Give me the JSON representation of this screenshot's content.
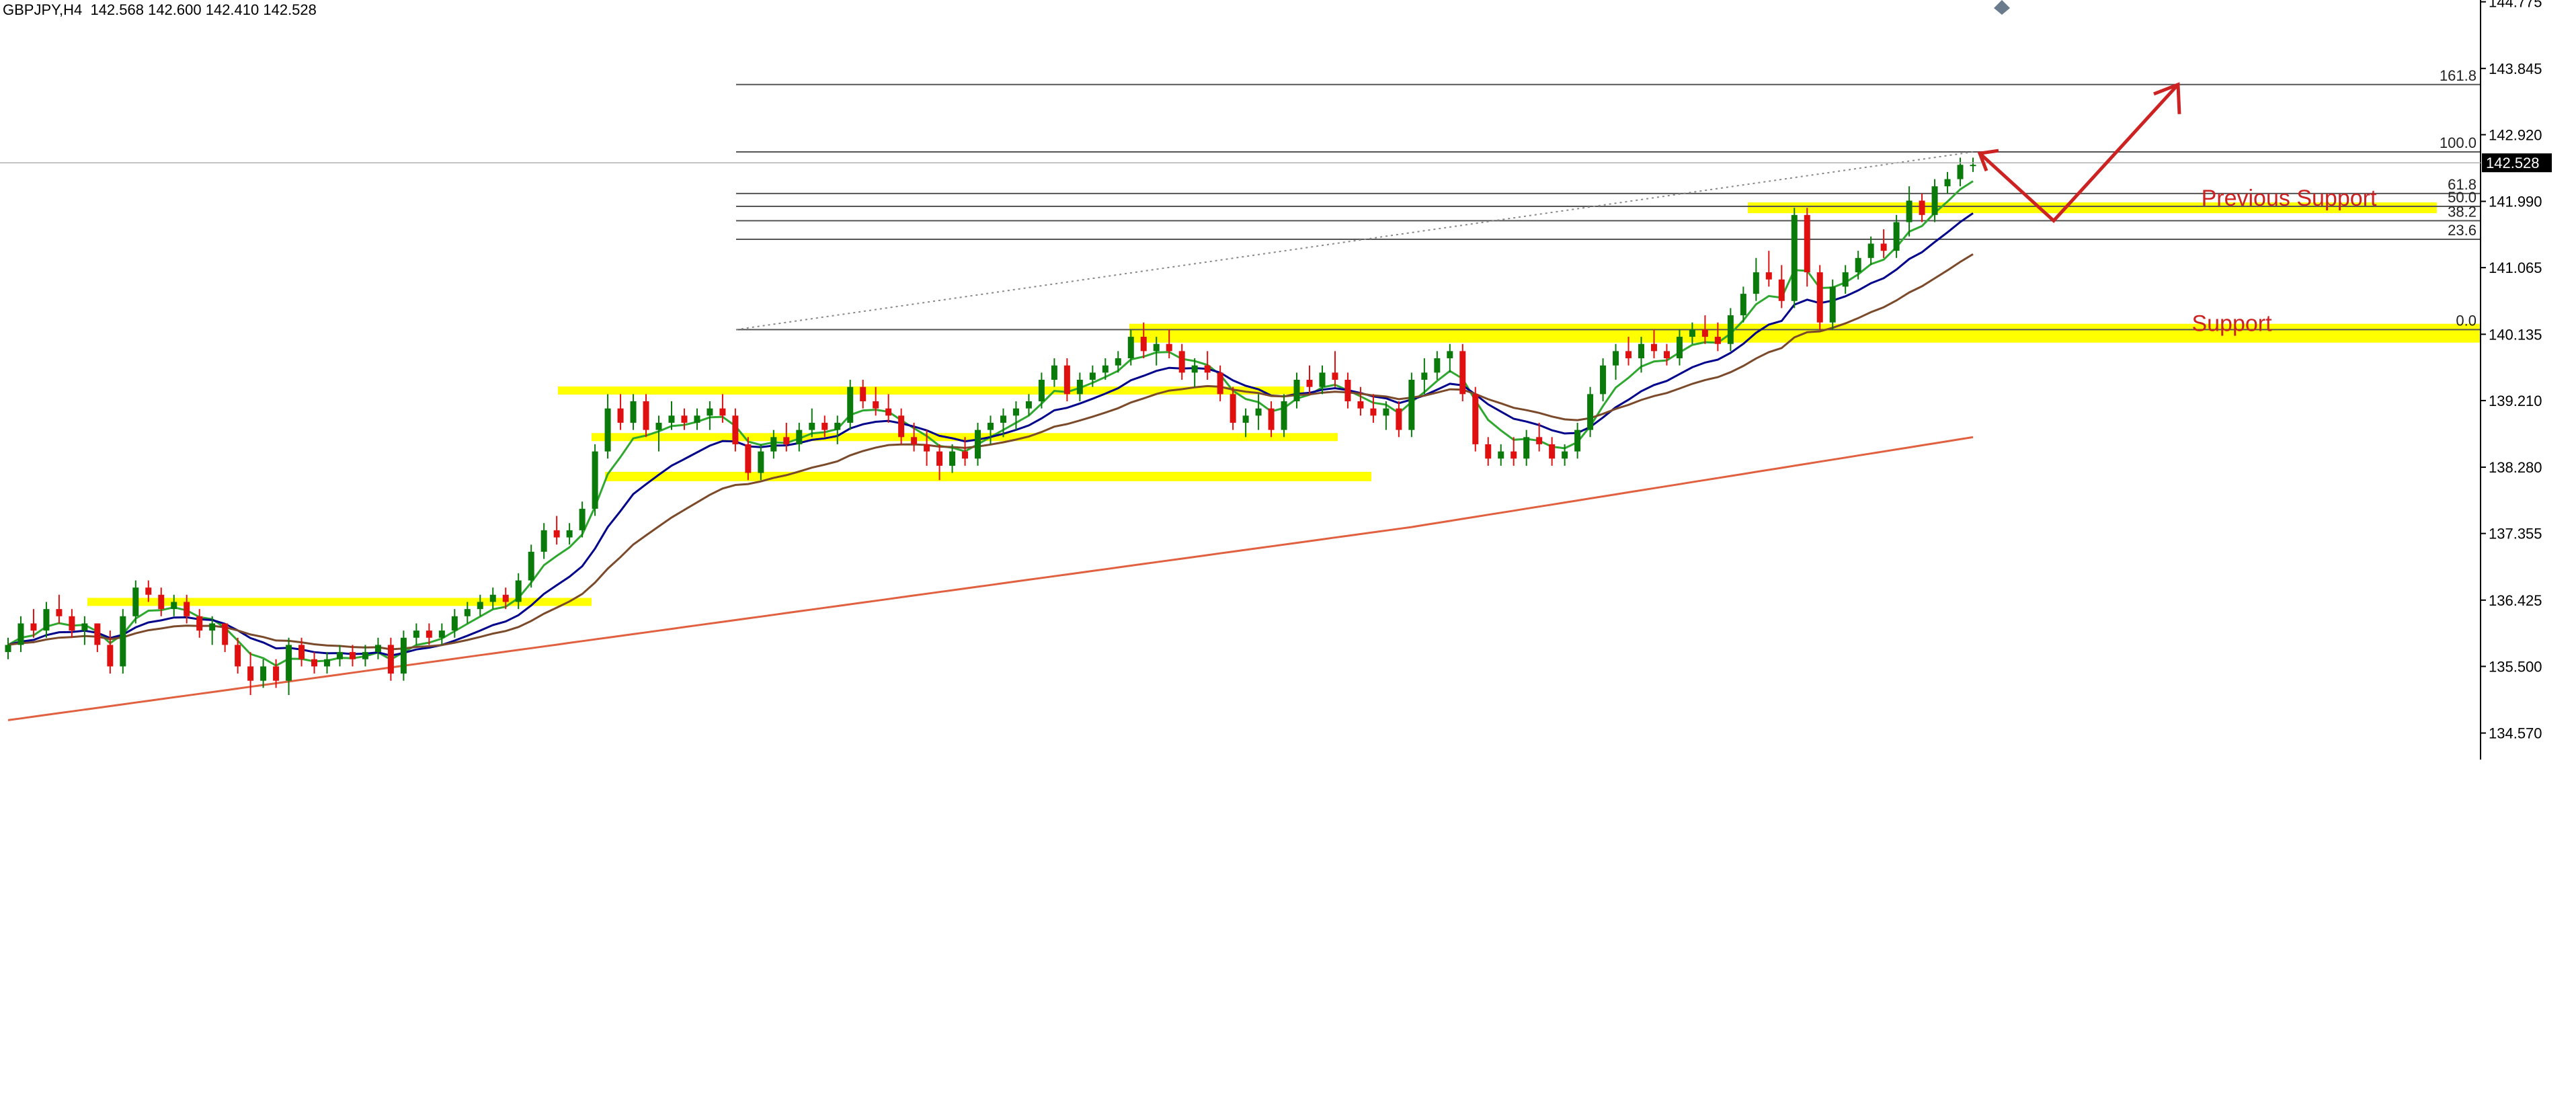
{
  "header": {
    "symbol_timeframe": "GBPJPY,H4",
    "ohlc": "142.568 142.600 142.410 142.528"
  },
  "chart_data": {
    "type": "candlestick",
    "symbol": "GBPJPY",
    "timeframe": "H4",
    "ylim": [
      134.2,
      144.8
    ],
    "price_ticks": [
      "144.775",
      "143.845",
      "142.920",
      "141.990",
      "141.065",
      "140.135",
      "139.210",
      "138.280",
      "137.355",
      "136.425",
      "135.500",
      "134.570"
    ],
    "last_price": "142.528",
    "colors": {
      "up": "#0a7a0a",
      "down": "#e01010",
      "ema_fast": "#2fa82f",
      "ema_mid": "#00008b",
      "ema_slow": "#7b4a2a",
      "ma_long": "#e06040",
      "zone": "#ffff00",
      "arrow": "#cc2222",
      "fib_line": "#555555"
    },
    "fibonacci": [
      {
        "label": "161.8",
        "price": 143.62
      },
      {
        "label": "100.0",
        "price": 142.68
      },
      {
        "label": "61.8",
        "price": 142.1
      },
      {
        "label": "50.0",
        "price": 141.92
      },
      {
        "label": "38.2",
        "price": 141.72
      },
      {
        "label": "23.6",
        "price": 141.46
      },
      {
        "label": "0.0",
        "price": 140.2
      }
    ],
    "annotations": [
      {
        "text": "Previous Support",
        "price": 141.95
      },
      {
        "text": "Support",
        "price": 140.2
      }
    ],
    "zones": [
      {
        "price": 136.4
      },
      {
        "price": 139.35
      },
      {
        "price": 138.7
      },
      {
        "price": 138.15
      },
      {
        "price": 140.15
      },
      {
        "price": 141.9
      }
    ],
    "candles": [
      [
        135.7,
        135.9,
        135.6,
        135.8
      ],
      [
        135.8,
        136.2,
        135.7,
        136.1
      ],
      [
        136.1,
        136.3,
        135.9,
        136.0
      ],
      [
        136.0,
        136.4,
        135.9,
        136.3
      ],
      [
        136.3,
        136.5,
        136.1,
        136.2
      ],
      [
        136.2,
        136.3,
        135.9,
        136.0
      ],
      [
        136.0,
        136.2,
        135.8,
        136.1
      ],
      [
        136.1,
        136.1,
        135.7,
        135.8
      ],
      [
        135.8,
        136.0,
        135.4,
        135.5
      ],
      [
        135.5,
        136.3,
        135.4,
        136.2
      ],
      [
        136.2,
        136.7,
        136.1,
        136.6
      ],
      [
        136.6,
        136.7,
        136.4,
        136.5
      ],
      [
        136.5,
        136.6,
        136.2,
        136.3
      ],
      [
        136.3,
        136.5,
        136.2,
        136.4
      ],
      [
        136.4,
        136.5,
        136.1,
        136.2
      ],
      [
        136.2,
        136.3,
        135.9,
        136.0
      ],
      [
        136.0,
        136.2,
        135.8,
        136.1
      ],
      [
        136.1,
        136.1,
        135.7,
        135.8
      ],
      [
        135.8,
        135.9,
        135.4,
        135.5
      ],
      [
        135.5,
        135.7,
        135.1,
        135.3
      ],
      [
        135.3,
        135.6,
        135.2,
        135.5
      ],
      [
        135.5,
        135.6,
        135.2,
        135.3
      ],
      [
        135.3,
        135.9,
        135.1,
        135.8
      ],
      [
        135.8,
        135.9,
        135.5,
        135.6
      ],
      [
        135.6,
        135.7,
        135.4,
        135.5
      ],
      [
        135.5,
        135.7,
        135.4,
        135.6
      ],
      [
        135.6,
        135.8,
        135.5,
        135.7
      ],
      [
        135.7,
        135.8,
        135.5,
        135.6
      ],
      [
        135.6,
        135.8,
        135.5,
        135.7
      ],
      [
        135.7,
        135.9,
        135.6,
        135.8
      ],
      [
        135.8,
        135.9,
        135.3,
        135.4
      ],
      [
        135.4,
        136.0,
        135.3,
        135.9
      ],
      [
        135.9,
        136.1,
        135.8,
        136.0
      ],
      [
        136.0,
        136.1,
        135.8,
        135.9
      ],
      [
        135.9,
        136.1,
        135.8,
        136.0
      ],
      [
        136.0,
        136.3,
        135.9,
        136.2
      ],
      [
        136.2,
        136.4,
        136.1,
        136.3
      ],
      [
        136.3,
        136.5,
        136.2,
        136.4
      ],
      [
        136.4,
        136.6,
        136.3,
        136.5
      ],
      [
        136.5,
        136.6,
        136.3,
        136.4
      ],
      [
        136.4,
        136.8,
        136.3,
        136.7
      ],
      [
        136.7,
        137.2,
        136.6,
        137.1
      ],
      [
        137.1,
        137.5,
        137.0,
        137.4
      ],
      [
        137.4,
        137.6,
        137.2,
        137.3
      ],
      [
        137.3,
        137.5,
        137.2,
        137.4
      ],
      [
        137.4,
        137.8,
        137.3,
        137.7
      ],
      [
        137.7,
        138.6,
        137.6,
        138.5
      ],
      [
        138.5,
        139.3,
        138.4,
        139.1
      ],
      [
        139.1,
        139.3,
        138.8,
        138.9
      ],
      [
        138.9,
        139.3,
        138.8,
        139.2
      ],
      [
        139.2,
        139.3,
        138.7,
        138.8
      ],
      [
        138.8,
        139.0,
        138.5,
        138.9
      ],
      [
        138.9,
        139.2,
        138.8,
        139.0
      ],
      [
        139.0,
        139.1,
        138.8,
        138.9
      ],
      [
        138.9,
        139.1,
        138.8,
        139.0
      ],
      [
        139.0,
        139.2,
        138.8,
        139.1
      ],
      [
        139.1,
        139.3,
        138.9,
        139.0
      ],
      [
        139.0,
        139.1,
        138.5,
        138.6
      ],
      [
        138.6,
        138.7,
        138.1,
        138.2
      ],
      [
        138.2,
        138.6,
        138.1,
        138.5
      ],
      [
        138.5,
        138.8,
        138.4,
        138.7
      ],
      [
        138.7,
        138.9,
        138.5,
        138.6
      ],
      [
        138.6,
        138.9,
        138.5,
        138.8
      ],
      [
        138.8,
        139.1,
        138.7,
        138.9
      ],
      [
        138.9,
        139.0,
        138.7,
        138.8
      ],
      [
        138.8,
        139.0,
        138.6,
        138.9
      ],
      [
        138.9,
        139.5,
        138.8,
        139.4
      ],
      [
        139.4,
        139.5,
        139.1,
        139.2
      ],
      [
        139.2,
        139.4,
        139.0,
        139.1
      ],
      [
        139.1,
        139.3,
        138.9,
        139.0
      ],
      [
        139.0,
        139.1,
        138.6,
        138.7
      ],
      [
        138.7,
        138.9,
        138.5,
        138.6
      ],
      [
        138.6,
        138.8,
        138.3,
        138.5
      ],
      [
        138.5,
        138.6,
        138.1,
        138.3
      ],
      [
        138.3,
        138.6,
        138.2,
        138.5
      ],
      [
        138.5,
        138.7,
        138.3,
        138.4
      ],
      [
        138.4,
        138.9,
        138.3,
        138.8
      ],
      [
        138.8,
        139.0,
        138.6,
        138.9
      ],
      [
        138.9,
        139.1,
        138.7,
        139.0
      ],
      [
        139.0,
        139.2,
        138.8,
        139.1
      ],
      [
        139.1,
        139.3,
        139.0,
        139.2
      ],
      [
        139.2,
        139.6,
        139.1,
        139.5
      ],
      [
        139.5,
        139.8,
        139.4,
        139.7
      ],
      [
        139.7,
        139.8,
        139.2,
        139.3
      ],
      [
        139.3,
        139.6,
        139.2,
        139.5
      ],
      [
        139.5,
        139.7,
        139.4,
        139.6
      ],
      [
        139.6,
        139.8,
        139.5,
        139.7
      ],
      [
        139.7,
        139.9,
        139.6,
        139.8
      ],
      [
        139.8,
        140.2,
        139.7,
        140.1
      ],
      [
        140.1,
        140.3,
        139.8,
        139.9
      ],
      [
        139.9,
        140.1,
        139.7,
        140.0
      ],
      [
        140.0,
        140.2,
        139.8,
        139.9
      ],
      [
        139.9,
        140.0,
        139.5,
        139.6
      ],
      [
        139.6,
        139.8,
        139.4,
        139.7
      ],
      [
        139.7,
        139.9,
        139.5,
        139.6
      ],
      [
        139.6,
        139.7,
        139.2,
        139.3
      ],
      [
        139.3,
        139.4,
        138.8,
        138.9
      ],
      [
        138.9,
        139.1,
        138.7,
        139.0
      ],
      [
        139.0,
        139.3,
        138.8,
        139.1
      ],
      [
        139.1,
        139.2,
        138.7,
        138.8
      ],
      [
        138.8,
        139.3,
        138.7,
        139.2
      ],
      [
        139.2,
        139.6,
        139.1,
        139.5
      ],
      [
        139.5,
        139.7,
        139.3,
        139.4
      ],
      [
        139.4,
        139.7,
        139.3,
        139.6
      ],
      [
        139.6,
        139.9,
        139.4,
        139.5
      ],
      [
        139.5,
        139.6,
        139.1,
        139.2
      ],
      [
        139.2,
        139.4,
        139.0,
        139.1
      ],
      [
        139.1,
        139.3,
        138.9,
        139.0
      ],
      [
        139.0,
        139.2,
        138.8,
        139.1
      ],
      [
        139.1,
        139.2,
        138.7,
        138.8
      ],
      [
        138.8,
        139.6,
        138.7,
        139.5
      ],
      [
        139.5,
        139.8,
        139.3,
        139.6
      ],
      [
        139.6,
        139.9,
        139.5,
        139.8
      ],
      [
        139.8,
        140.0,
        139.6,
        139.9
      ],
      [
        139.9,
        140.0,
        139.2,
        139.3
      ],
      [
        139.3,
        139.4,
        138.5,
        138.6
      ],
      [
        138.6,
        138.7,
        138.3,
        138.4
      ],
      [
        138.4,
        138.6,
        138.3,
        138.5
      ],
      [
        138.5,
        138.7,
        138.3,
        138.4
      ],
      [
        138.4,
        138.8,
        138.3,
        138.7
      ],
      [
        138.7,
        138.9,
        138.5,
        138.6
      ],
      [
        138.6,
        138.7,
        138.3,
        138.4
      ],
      [
        138.4,
        138.6,
        138.3,
        138.5
      ],
      [
        138.5,
        138.9,
        138.4,
        138.8
      ],
      [
        138.8,
        139.4,
        138.7,
        139.3
      ],
      [
        139.3,
        139.8,
        139.2,
        139.7
      ],
      [
        139.7,
        140.0,
        139.5,
        139.9
      ],
      [
        139.9,
        140.1,
        139.7,
        139.8
      ],
      [
        139.8,
        140.1,
        139.6,
        140.0
      ],
      [
        140.0,
        140.2,
        139.8,
        139.9
      ],
      [
        139.9,
        140.0,
        139.7,
        139.8
      ],
      [
        139.8,
        140.2,
        139.7,
        140.1
      ],
      [
        140.1,
        140.3,
        140.0,
        140.2
      ],
      [
        140.2,
        140.4,
        140.0,
        140.1
      ],
      [
        140.1,
        140.3,
        139.9,
        140.0
      ],
      [
        140.0,
        140.5,
        139.9,
        140.4
      ],
      [
        140.4,
        140.8,
        140.3,
        140.7
      ],
      [
        140.7,
        141.2,
        140.6,
        141.0
      ],
      [
        141.0,
        141.3,
        140.8,
        140.9
      ],
      [
        140.9,
        141.1,
        140.5,
        140.6
      ],
      [
        140.6,
        141.9,
        140.5,
        141.8
      ],
      [
        141.8,
        141.9,
        140.8,
        141.0
      ],
      [
        141.0,
        141.1,
        140.2,
        140.3
      ],
      [
        140.3,
        140.9,
        140.2,
        140.8
      ],
      [
        140.8,
        141.1,
        140.7,
        141.0
      ],
      [
        141.0,
        141.3,
        140.9,
        141.2
      ],
      [
        141.2,
        141.5,
        141.1,
        141.4
      ],
      [
        141.4,
        141.6,
        141.2,
        141.3
      ],
      [
        141.3,
        141.8,
        141.2,
        141.7
      ],
      [
        141.7,
        142.2,
        141.5,
        142.0
      ],
      [
        142.0,
        142.1,
        141.7,
        141.8
      ],
      [
        141.8,
        142.3,
        141.7,
        142.2
      ],
      [
        142.2,
        142.4,
        142.1,
        142.3
      ],
      [
        142.3,
        142.6,
        142.2,
        142.5
      ],
      [
        142.5,
        142.6,
        142.4,
        142.5
      ]
    ]
  }
}
